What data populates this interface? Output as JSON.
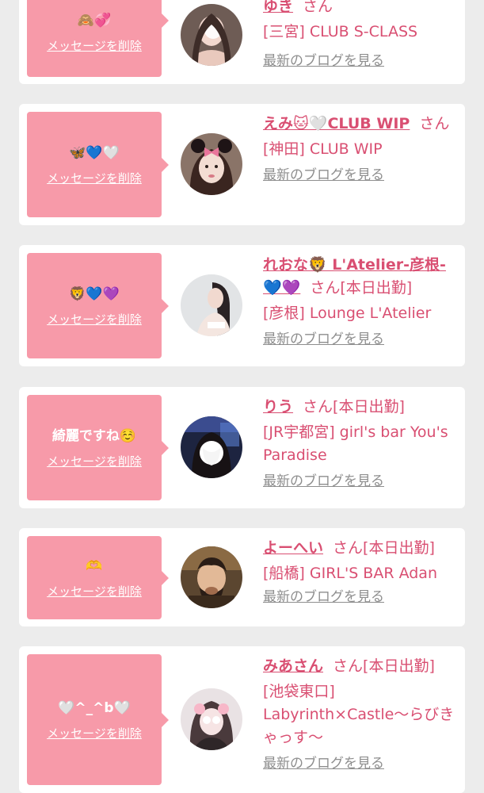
{
  "messages": [
    {
      "message": "🙈💞",
      "delete_label": "メッセージを削除",
      "name": "ゆき",
      "honorific": "さん",
      "status": "",
      "shop": "[三宮] CLUB S-CLASS",
      "blog_link": "最新のブログを見る",
      "avatar": "avatar-photo-icon"
    },
    {
      "message": "🦋💙🤍",
      "delete_label": "メッセージを削除",
      "name": "えみ🐱🤍CLUB WIP",
      "honorific": "さん",
      "status": "",
      "shop": "[神田] CLUB WIP",
      "blog_link": "最新のブログを見る",
      "avatar": "avatar-photo-icon"
    },
    {
      "message": "🦁💙💜",
      "delete_label": "メッセージを削除",
      "name": "れおな🦁 L'Atelier-彦根-💙💜",
      "honorific": "さん",
      "status": "[本日出勤]",
      "shop": "[彦根] Lounge L'Atelier",
      "blog_link": "最新のブログを見る",
      "avatar": "avatar-photo-icon"
    },
    {
      "message": "綺麗ですね☺️",
      "delete_label": "メッセージを削除",
      "name": "りう",
      "honorific": "さん",
      "status": "[本日出勤]",
      "shop": "[JR宇都宮] girl's bar You's Paradise",
      "blog_link": "最新のブログを見る",
      "avatar": "avatar-photo-icon"
    },
    {
      "message": "🫶",
      "delete_label": "メッセージを削除",
      "name": "よーへい",
      "honorific": "さん",
      "status": "[本日出勤]",
      "shop": "[船橋] GIRL'S BAR Adan",
      "blog_link": "最新のブログを見る",
      "avatar": "avatar-photo-icon"
    },
    {
      "message": "🤍^_^b🤍",
      "delete_label": "メッセージを削除",
      "name": "みあさん",
      "honorific": "さん",
      "status": "[本日出勤]",
      "shop": "[池袋東口] Labyrinth×Castle〜らびきゃっす〜",
      "blog_link": "最新のブログを見る",
      "avatar": "avatar-photo-icon"
    }
  ],
  "colors": {
    "accent": "#d94f72",
    "bubble": "#f79aa9",
    "background": "#ececec",
    "muted_link": "#8e8e8e"
  }
}
